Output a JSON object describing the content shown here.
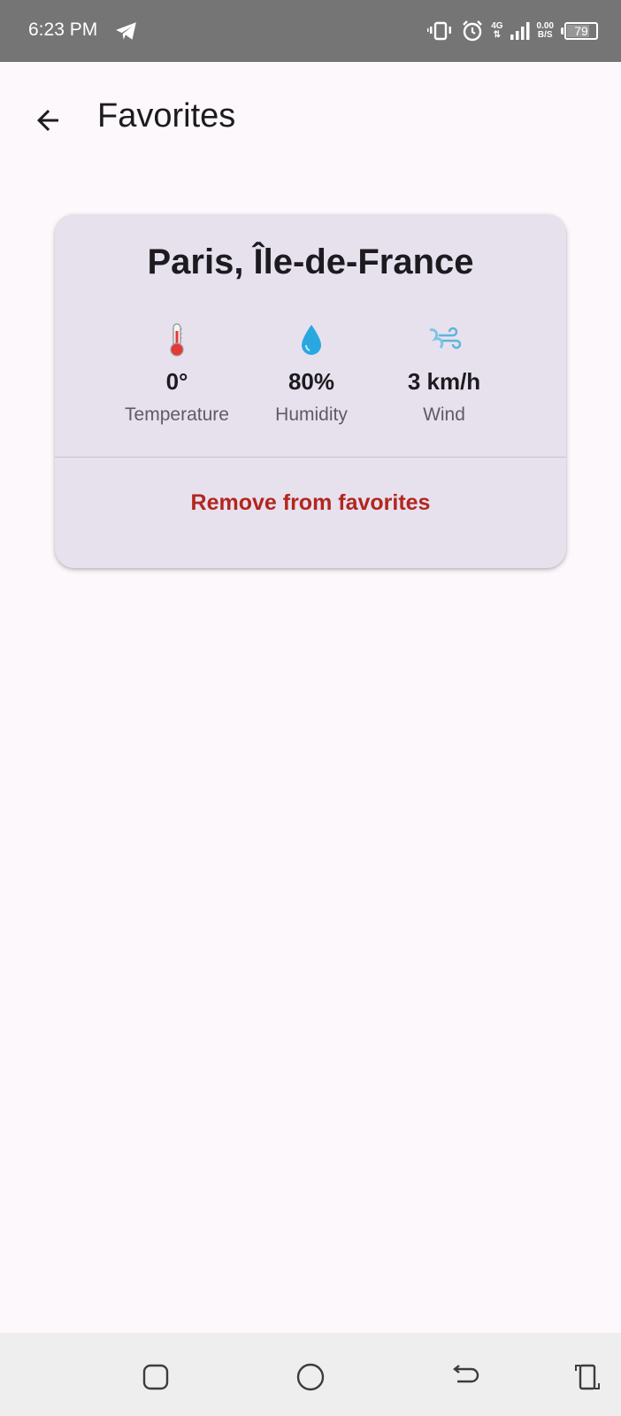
{
  "status_bar": {
    "time": "6:23 PM",
    "network": "4G",
    "speed_value": "0.00",
    "speed_unit": "B/S",
    "battery": "79",
    "battery_level": 0.79,
    "icons": [
      "telegram-icon",
      "vibrate-icon",
      "alarm-icon",
      "signal-icon",
      "battery-icon"
    ]
  },
  "app_bar": {
    "title": "Favorites",
    "back_icon": "arrow-back-icon"
  },
  "favorites": [
    {
      "city": "Paris, Île-de-France",
      "stats": [
        {
          "icon": "thermometer-icon",
          "value": "0°",
          "label": "Temperature"
        },
        {
          "icon": "droplet-icon",
          "value": "80%",
          "label": "Humidity"
        },
        {
          "icon": "wind-icon",
          "value": "3 km/h",
          "label": "Wind"
        }
      ],
      "remove_label": "Remove from favorites"
    }
  ],
  "nav_bar": {
    "buttons": [
      "recents-icon",
      "home-icon",
      "back-icon",
      "rotate-icon"
    ]
  },
  "colors": {
    "background": "#fdf8fc",
    "card": "#e7e1ee",
    "danger": "#b3261e",
    "status_bar": "#757575",
    "nav_bar": "#eeeeee"
  }
}
